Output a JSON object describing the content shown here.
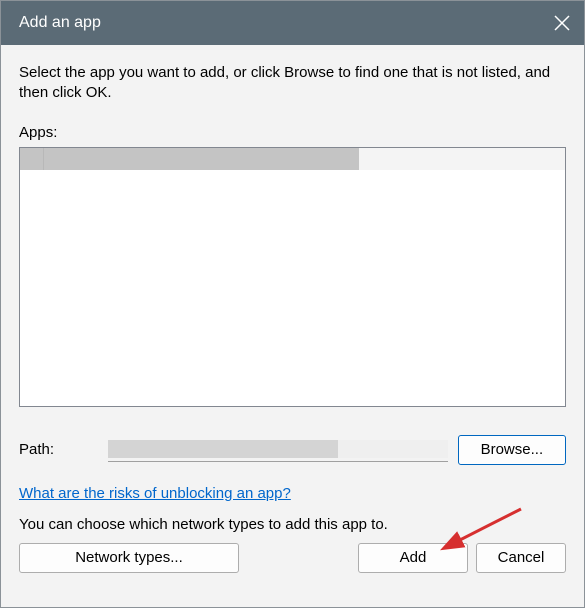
{
  "window": {
    "title": "Add an app"
  },
  "instruction": "Select the app you want to add, or click Browse to find one that is not listed, and then click OK.",
  "apps_label": "Apps:",
  "path_label": "Path:",
  "buttons": {
    "browse": "Browse...",
    "network": "Network types...",
    "add": "Add",
    "cancel": "Cancel"
  },
  "links": {
    "risks": "What are the risks of unblocking an app?"
  },
  "network_text": "You can choose which network types to add this app to."
}
